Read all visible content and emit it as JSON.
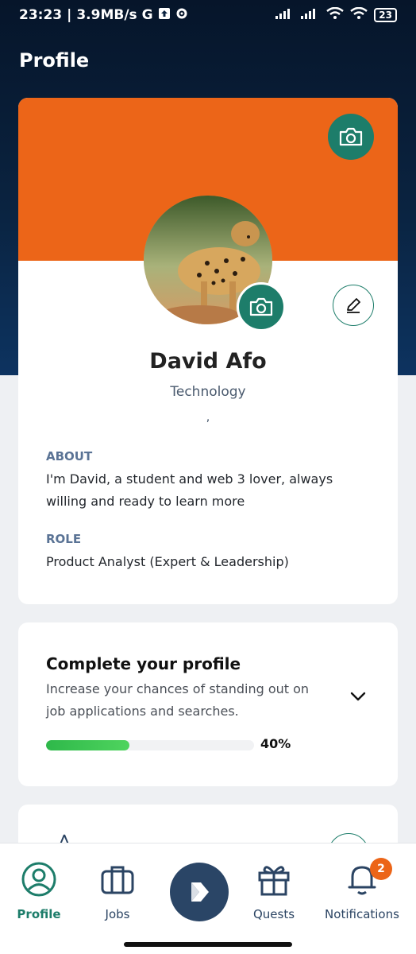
{
  "status_bar": {
    "time": "23:23",
    "speed": "3.9MB/s",
    "battery": "23"
  },
  "page": {
    "title": "Profile"
  },
  "profile": {
    "name": "David Afo",
    "industry": "Technology",
    "location_separator": ",",
    "about_label": "ABOUT",
    "about_text": "I'm David, a student and web 3 lover, always willing and ready to learn more",
    "role_label": "ROLE",
    "role_text": "Product Analyst (Expert & Leadership)"
  },
  "complete_profile": {
    "title": "Complete your profile",
    "description": "Increase your chances of standing out on job applications and searches.",
    "progress_label": "40%",
    "progress_fraction": 0.4
  },
  "bottom_nav": {
    "items": [
      {
        "label": "Profile",
        "icon": "user-circle-icon",
        "active": true
      },
      {
        "label": "Jobs",
        "icon": "briefcase-icon",
        "active": false
      },
      {
        "label": "",
        "icon": "app-logo-icon",
        "active": false
      },
      {
        "label": "Quests",
        "icon": "gift-icon",
        "active": false
      },
      {
        "label": "Notifications",
        "icon": "bell-icon",
        "active": false,
        "badge": "2"
      }
    ]
  },
  "colors": {
    "accent_orange": "#ec6518",
    "accent_teal": "#1d7d6a",
    "navy": "#0a2340",
    "progress_green": "#4fd45e"
  }
}
